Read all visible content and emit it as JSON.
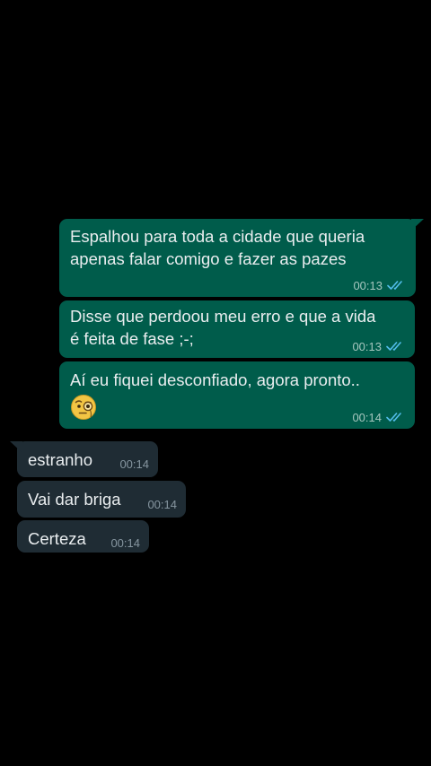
{
  "chat": {
    "outgoing": [
      {
        "text": "Espalhou para toda a cidade que queria\napenas falar comigo e fazer as pazes",
        "time": "00:13",
        "status": "read"
      },
      {
        "text": "Disse que perdoou meu erro e que a vida\né feita de fase ;-;",
        "time": "00:13",
        "status": "read"
      },
      {
        "text": "Aí eu fiquei desconfiado, agora pronto..",
        "emoji": "face-with-monocle",
        "time": "00:14",
        "status": "read"
      }
    ],
    "incoming": [
      {
        "text": "estranho",
        "time": "00:14"
      },
      {
        "text": "Vai dar briga",
        "time": "00:14"
      },
      {
        "text": "Certeza",
        "time": "00:14"
      }
    ]
  },
  "colors": {
    "background": "#000000",
    "outgoing_bubble": "#005c4b",
    "incoming_bubble": "#1f2c34",
    "read_ticks": "#53bdeb",
    "message_text": "#e9edef"
  },
  "icons": {
    "read_receipt": "double-check-icon",
    "emoji": "face-with-monocle-emoji-icon"
  }
}
